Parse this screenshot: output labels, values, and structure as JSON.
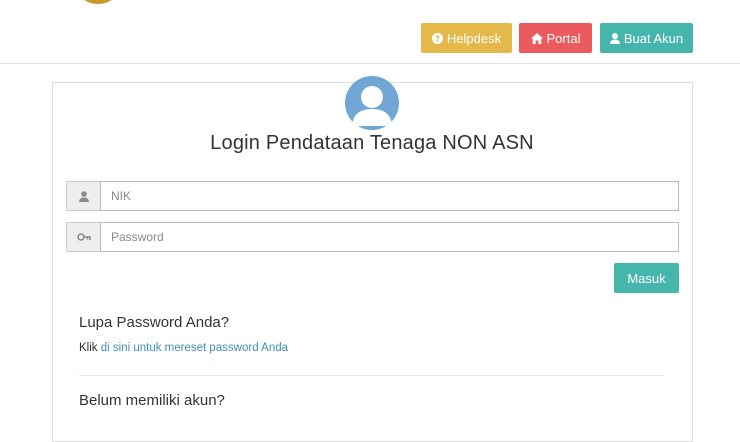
{
  "header": {
    "buttons": {
      "helpdesk": {
        "label": "Helpdesk",
        "icon": "question-circle-icon",
        "color": "#e5b84a"
      },
      "portal": {
        "label": "Portal",
        "icon": "home-icon",
        "color": "#ea5a5e"
      },
      "buat_akun": {
        "label": "Buat Akun",
        "icon": "user-icon",
        "color": "#46b6ad"
      }
    }
  },
  "login": {
    "avatar_icon": "user-avatar-icon",
    "title": "Login Pendataan Tenaga NON ASN",
    "nik": {
      "placeholder": "NIK",
      "icon": "user-icon",
      "value": ""
    },
    "password": {
      "placeholder": "Password",
      "icon": "key-icon",
      "value": ""
    },
    "submit_label": "Masuk"
  },
  "forgot": {
    "heading": "Lupa Password Anda?",
    "prefix": "Klik",
    "link": "di sini untuk mereset password Anda"
  },
  "no_account": {
    "heading": "Belum memiliki akun?"
  },
  "colors": {
    "accent_teal": "#46b6ad",
    "link_blue": "#3f8fb8",
    "avatar_blue": "#6fa6d4"
  }
}
